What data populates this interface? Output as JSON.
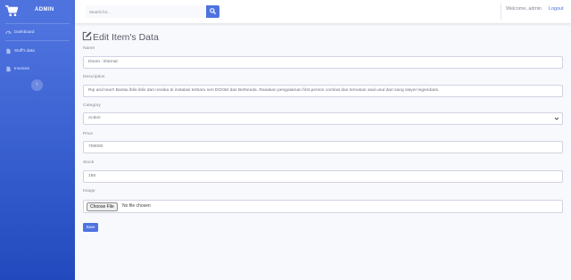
{
  "brand": {
    "name": "ADMIN",
    "icon": "cart-icon"
  },
  "sidebar": {
    "items": [
      {
        "label": "Dashboard",
        "icon": "dashboard-icon"
      },
      {
        "label": "Stuff's data",
        "icon": "file-icon"
      },
      {
        "label": "Invoices",
        "icon": "file-icon"
      }
    ],
    "toggle_icon": "chevron-left-icon"
  },
  "topbar": {
    "search_placeholder": "Search for...",
    "search_icon": "search-icon",
    "welcome": "Welcome, admin",
    "logout": "Logout"
  },
  "page": {
    "title": "Edit Item's Data",
    "title_icon": "edit-icon"
  },
  "form": {
    "name": {
      "label": "Name",
      "value": "Doom : Eternal"
    },
    "description": {
      "label": "Description",
      "value": "Rip and tear!! Bantai iblis-iblis dari neraka di instalasi terbaru seri DOOM dari Bethesda. Rasakan pengalaman first person combat dan temukan asal usul dari sang slayer legendaris."
    },
    "category": {
      "label": "Category",
      "value": "Action"
    },
    "price": {
      "label": "Price",
      "value": "700000"
    },
    "stock": {
      "label": "Stock",
      "value": "150"
    },
    "image": {
      "label": "Image",
      "button": "Choose File",
      "status": "No file chosen"
    },
    "save_label": "Save"
  },
  "colors": {
    "primary": "#4e73df",
    "sidebar_start": "#4e73df",
    "sidebar_end": "#224abe",
    "background": "#f8f9fc"
  }
}
